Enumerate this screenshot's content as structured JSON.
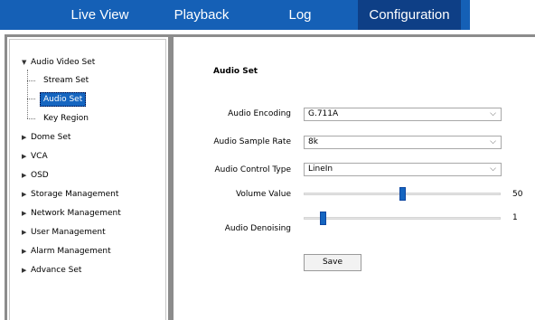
{
  "nav": {
    "tabs": [
      {
        "label": "Live View"
      },
      {
        "label": "Playback"
      },
      {
        "label": "Log"
      },
      {
        "label": "Configuration",
        "active": true
      }
    ]
  },
  "sidebar": {
    "groups": [
      {
        "label": "Audio Video Set",
        "expanded": true,
        "children": [
          "Stream Set",
          "Audio Set",
          "Key Region"
        ],
        "selected": "Audio Set"
      },
      {
        "label": "Dome Set"
      },
      {
        "label": "VCA"
      },
      {
        "label": "OSD"
      },
      {
        "label": "Storage Management"
      },
      {
        "label": "Network Management"
      },
      {
        "label": "User Management"
      },
      {
        "label": "Alarm Management"
      },
      {
        "label": "Advance Set"
      }
    ]
  },
  "main": {
    "section_title": "Audio Set",
    "fields": {
      "encoding": {
        "label": "Audio Encoding",
        "value": "G.711A"
      },
      "sample_rate": {
        "label": "Audio Sample Rate",
        "value": "8k"
      },
      "control_type": {
        "label": "Audio Control Type",
        "value": "LineIn"
      },
      "volume": {
        "label": "Volume Value",
        "value": "50",
        "fraction": 0.5
      },
      "denoising": {
        "label": "Audio Denoising",
        "value": "1",
        "fraction": 0.1
      }
    },
    "save_label": "Save"
  },
  "colors": {
    "nav_bg": "#1560b6",
    "nav_active": "#0e3f86",
    "accent": "#1565c0"
  }
}
